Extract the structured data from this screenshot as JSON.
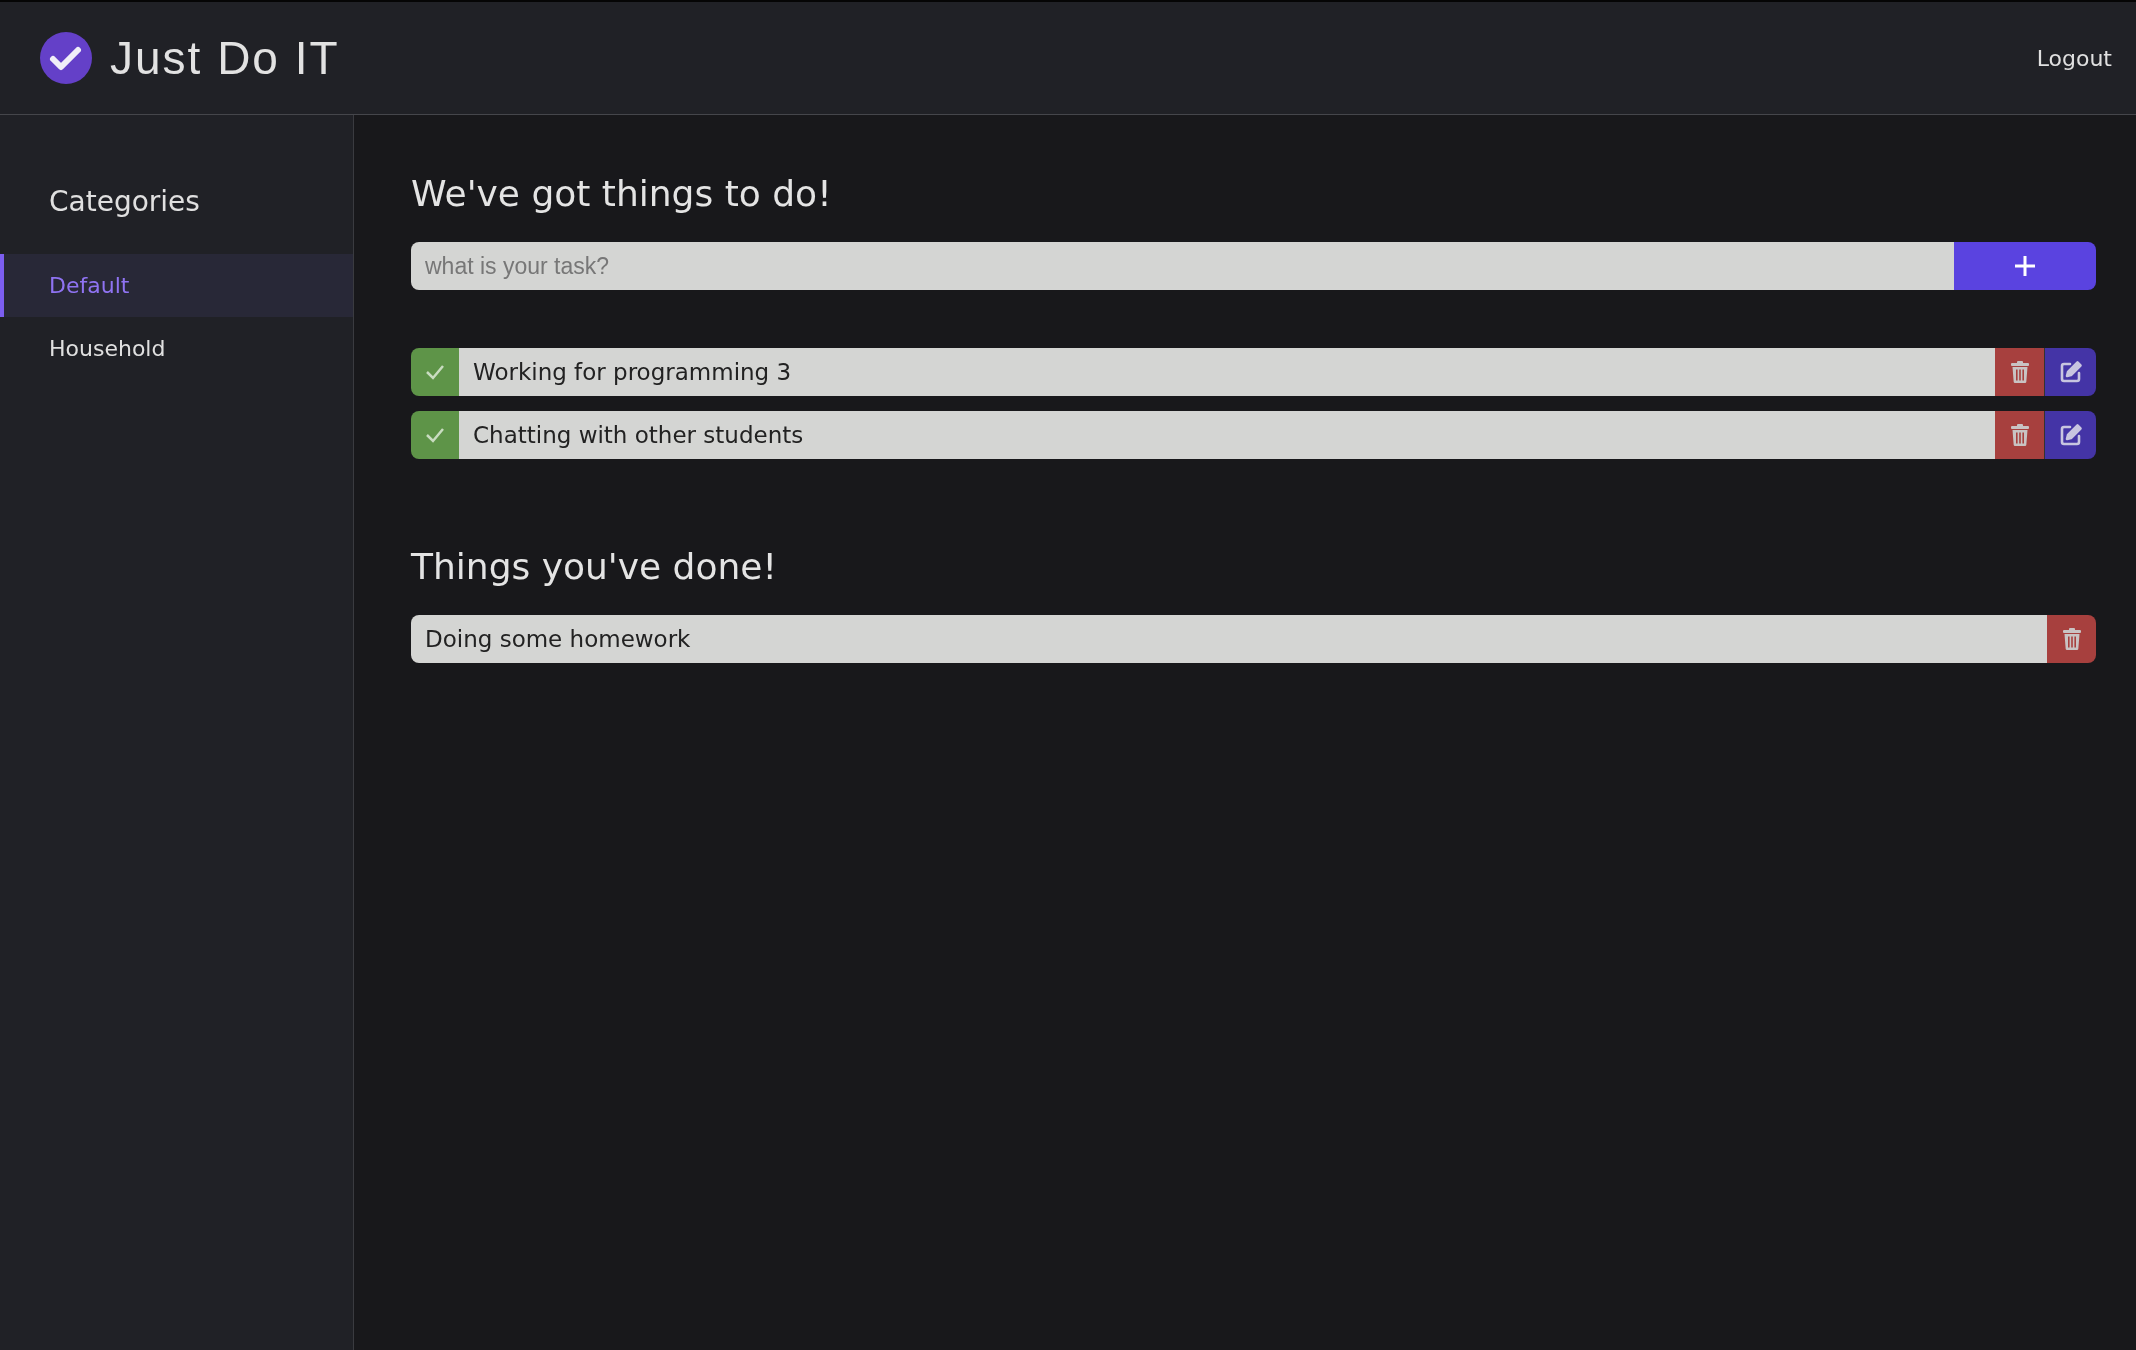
{
  "header": {
    "title": "Just Do IT",
    "logout": "Logout"
  },
  "sidebar": {
    "title": "Categories",
    "items": [
      {
        "label": "Default",
        "selected": true
      },
      {
        "label": "Household",
        "selected": false
      }
    ]
  },
  "todo": {
    "heading": "We've got things to do!",
    "input": {
      "placeholder": "what is your task?"
    },
    "tasks": [
      {
        "text": "Working for programming 3"
      },
      {
        "text": "Chatting with other students"
      }
    ]
  },
  "done": {
    "heading": "Things you've done!",
    "tasks": [
      {
        "text": "Doing some homework"
      }
    ]
  }
}
